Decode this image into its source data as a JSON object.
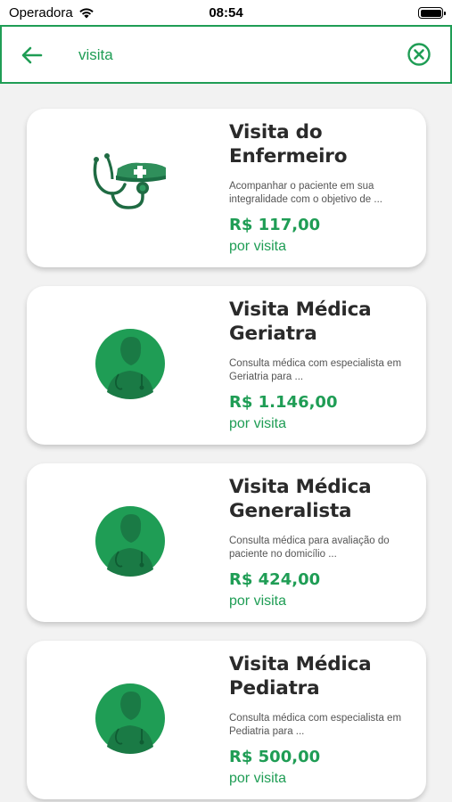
{
  "status_bar": {
    "carrier": "Operadora",
    "time": "08:54"
  },
  "search": {
    "value": "visita"
  },
  "colors": {
    "accent": "#1f9d55",
    "card": "#ffffff",
    "background": "#f2f2f2"
  },
  "results": [
    {
      "title": "Visita do Enfermeiro",
      "description": "Acompanhar o paciente em sua integralidade com o objetivo de ...",
      "price": "R$ 117,00",
      "unit": "por visita",
      "icon": "nurse-stethoscope-icon"
    },
    {
      "title": "Visita Médica Geriatra",
      "description": "Consulta médica com especialista em Geriatria para ...",
      "price": "R$ 1.146,00",
      "unit": "por visita",
      "icon": "doctor-avatar-icon"
    },
    {
      "title": "Visita Médica Generalista",
      "description": "Consulta médica para avaliação do paciente no domicílio ...",
      "price": "R$ 424,00",
      "unit": "por visita",
      "icon": "doctor-avatar-icon"
    },
    {
      "title": "Visita Médica Pediatra",
      "description": "Consulta médica com especialista em Pediatria para ...",
      "price": "R$ 500,00",
      "unit": "por visita",
      "icon": "doctor-avatar-icon"
    }
  ]
}
